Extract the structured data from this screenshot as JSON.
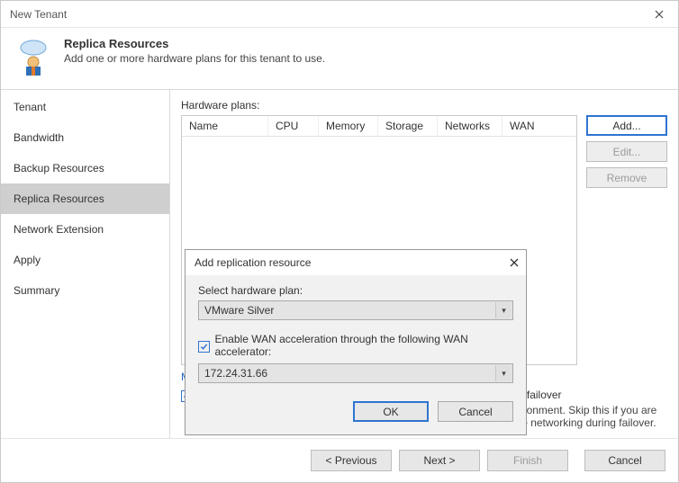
{
  "window": {
    "title": "New Tenant"
  },
  "header": {
    "title": "Replica Resources",
    "subtitle": "Add one or more hardware plans for this tenant to use."
  },
  "sidebar": {
    "items": [
      {
        "label": "Tenant"
      },
      {
        "label": "Bandwidth"
      },
      {
        "label": "Backup Resources"
      },
      {
        "label": "Replica Resources"
      },
      {
        "label": "Network Extension"
      },
      {
        "label": "Apply"
      },
      {
        "label": "Summary"
      }
    ],
    "active_index": 3
  },
  "main": {
    "grid_label": "Hardware plans:",
    "columns": [
      "Name",
      "CPU",
      "Memory",
      "Storage",
      "Networks",
      "WAN"
    ],
    "side_buttons": {
      "add": "Add...",
      "edit": "Edit...",
      "remove": "Remove"
    },
    "manage_link": "Manage network settings",
    "ext_checkbox_label": "Use Veeam network extension capabilities during partial and full site failover",
    "ext_help": "The network extension appliance will be deployed to the tenant environment. Skip this if you are already using a 3rd party solution like VMware NSX Edge to manage networking during failover."
  },
  "dialog": {
    "title": "Add replication resource",
    "select_label": "Select hardware plan:",
    "plan_value": "VMware Silver",
    "wan_checkbox_label": "Enable WAN acceleration through the following WAN accelerator:",
    "wan_value": "172.24.31.66",
    "ok": "OK",
    "cancel": "Cancel"
  },
  "footer": {
    "previous": "< Previous",
    "next": "Next >",
    "finish": "Finish",
    "cancel": "Cancel"
  }
}
